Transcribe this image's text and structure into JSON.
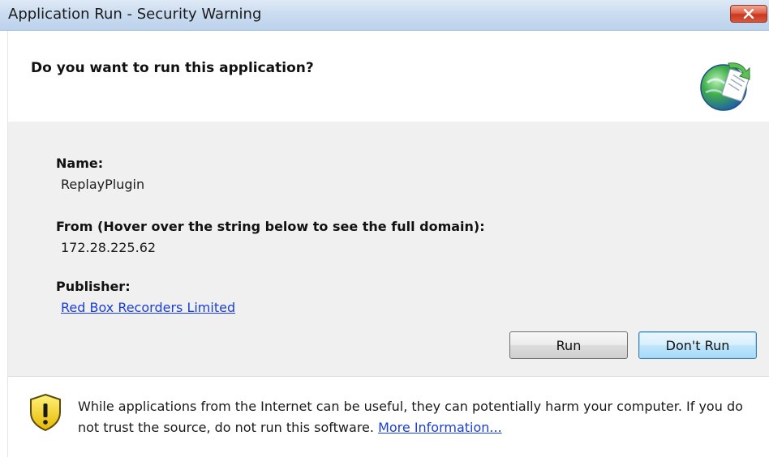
{
  "window": {
    "title": "Application Run - Security Warning"
  },
  "header": {
    "question": "Do you want to run this application?",
    "icon": "globe-arrow-icon"
  },
  "details": {
    "name_label": "Name:",
    "name_value": "ReplayPlugin",
    "from_label": "From (Hover over the string below to see the full domain):",
    "from_value": "172.28.225.62",
    "publisher_label": "Publisher:",
    "publisher_value": "Red Box Recorders Limited"
  },
  "buttons": {
    "run": "Run",
    "dont_run": "Don't Run"
  },
  "footer": {
    "icon": "shield-warning-icon",
    "warning_text": "While applications from the Internet can be useful, they can potentially harm your computer. If you do not trust the source, do not run this software.",
    "more_info_link": "More Information..."
  },
  "colors": {
    "titlebar": "#c9dbef",
    "body": "#f0f0f0",
    "link": "#1a3fd6",
    "close": "#d9573d"
  }
}
